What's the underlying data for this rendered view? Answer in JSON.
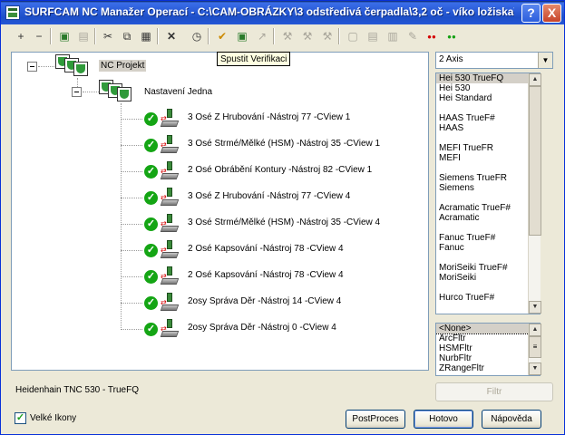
{
  "window": {
    "title": "SURFCAM NC Manažer Operací - C:\\CAM-OBRÁZKY\\3 odstředivá čerpadla\\3,2 oč - víko ložiska\\vi...",
    "help_label": "?",
    "close_label": "X"
  },
  "toolbar": {
    "tooltip": "Spustit Verifikaci",
    "icons": [
      "add-icon",
      "remove-icon",
      "copy-operation-icon",
      "move-operation-icon",
      "cut-icon",
      "copy-icon",
      "paste-icon",
      "delete-icon",
      "clock-icon",
      "verify-icon",
      "post-icon",
      "edit-disabled-icon",
      "tool-icon",
      "tool2-icon",
      "tool3-icon",
      "page-icon",
      "page-edit-icon",
      "page-tools-icon",
      "page-fix-icon",
      "red-dots-icon",
      "green-dots-icon"
    ],
    "glyphs": [
      "+",
      "−",
      "▣",
      "▤",
      "✂",
      "⧉",
      "▦",
      "✕",
      "◷",
      "✔",
      "▣",
      "↗",
      "⚒",
      "⚒",
      "⚒",
      "▢",
      "▤",
      "▥",
      "✎",
      "●●",
      "●●"
    ]
  },
  "tree": {
    "root_label": "NC Projekt",
    "group_label": "Nastavení Jedna",
    "operations": [
      "3 Osé Z Hrubování  -Nástroj 77 -CView 1",
      "3 Osé Strmé/Mělké (HSM)  -Nástroj 35 -CView 1",
      "2 Osé Obrábění Kontury  -Nástroj 82 -CView 1",
      "3 Osé Z Hrubování  -Nástroj 77 -CView 4",
      "3 Osé Strmé/Mělké (HSM)  -Nástroj 35 -CView 4",
      "2 Osé Kapsování  -Nástroj 78 -CView 4",
      "2 Osé Kapsování  -Nástroj 78 -CView 4",
      "2osy Správa Děr  -Nástroj 14 -CView 4",
      "2osy Správa Děr  -Nástroj 0 -CView 4"
    ]
  },
  "axis_select": {
    "value": "2 Axis",
    "arrow": "▼"
  },
  "post_list": [
    "Hei 530 TrueFQ",
    "Hei 530",
    "Hei Standard",
    "",
    "HAAS TrueF#",
    "HAAS",
    "",
    "MEFI TrueFR",
    "MEFI",
    "",
    "Siemens TrueFR",
    "Siemens",
    "",
    "Acramatic TrueF#",
    "Acramatic",
    "",
    "Fanuc TrueF#",
    "Fanuc",
    "",
    "MoriSeiki TrueF#",
    "MoriSeiki",
    "",
    "Hurco TrueF#"
  ],
  "filter_list": [
    "<None>",
    "ArcFltr",
    "HSMFltr",
    "NurbFltr",
    "ZRangeFltr"
  ],
  "status_text": "Heidenhain TNC 530 - TrueFQ",
  "buttons": {
    "filter": "Filtr",
    "postproces": "PostProces",
    "done": "Hotovo",
    "help": "Nápověda"
  },
  "large_icons": {
    "label": "Velké Ikony",
    "checked": true,
    "mark": "✓"
  },
  "scroll_glyphs": {
    "up": "▲",
    "down": "▼",
    "grip": "≡"
  },
  "check_glyph": "✓",
  "arrow_glyph": "⇄",
  "collapse_glyph": "−"
}
